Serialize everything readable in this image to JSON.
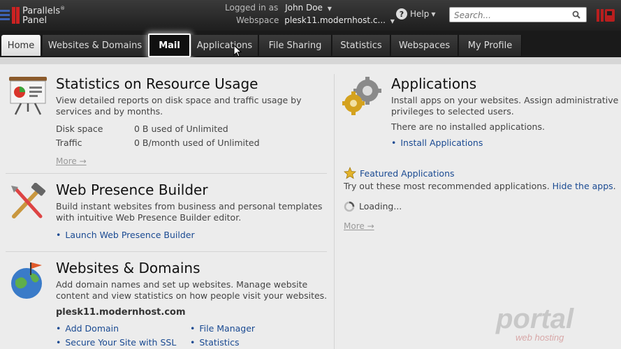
{
  "header": {
    "logo_line1": "Parallels",
    "logo_line2": "Panel",
    "logged_in_label": "Logged in as",
    "user_name": "John Doe",
    "webspace_label": "Webspace",
    "webspace_value": "plesk11.modernhost.c...",
    "help_label": "Help",
    "search_placeholder": "Search..."
  },
  "tabs": [
    {
      "label": "Home"
    },
    {
      "label": "Websites & Domains"
    },
    {
      "label": "Mail"
    },
    {
      "label": "Applications"
    },
    {
      "label": "File Sharing"
    },
    {
      "label": "Statistics"
    },
    {
      "label": "Webspaces"
    },
    {
      "label": "My Profile"
    }
  ],
  "stats": {
    "title": "Statistics on Resource Usage",
    "description": "View detailed reports on disk space and traffic usage by services and by months.",
    "rows": [
      {
        "key": "Disk space",
        "value": "0 B used of Unlimited"
      },
      {
        "key": "Traffic",
        "value": "0 B/month used of Unlimited"
      }
    ],
    "more": "More →"
  },
  "wpb": {
    "title": "Web Presence Builder",
    "description": "Build instant websites from business and personal templates with intuitive Web Presence Builder editor.",
    "link": "Launch Web Presence Builder"
  },
  "wd": {
    "title": "Websites & Domains",
    "description": "Add domain names and set up websites. Manage website content and view statistics on how people visit your websites.",
    "domain": "plesk11.modernhost.com",
    "links_col1": [
      "Add Domain",
      "Secure Your Site with SSL"
    ],
    "links_col2": [
      "File Manager",
      "Statistics"
    ]
  },
  "apps": {
    "title": "Applications",
    "description": "Install apps on your websites. Assign administrative privileges to selected users.",
    "status": "There are no installed applications.",
    "link": "Install Applications",
    "featured_title": "Featured Applications",
    "featured_desc": "Try out these most recommended applications.",
    "hide_link": "Hide the apps",
    "loading": "Loading...",
    "more": "More →"
  },
  "watermark": {
    "line1": "portal",
    "line2": "web hosting"
  }
}
